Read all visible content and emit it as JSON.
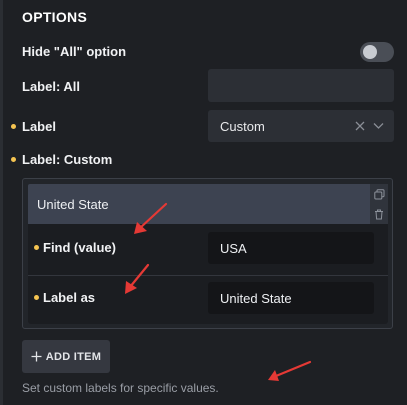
{
  "section": {
    "title": "OPTIONS"
  },
  "hide_all": {
    "label": "Hide \"All\" option",
    "enabled": false
  },
  "label_all": {
    "label": "Label: All",
    "value": ""
  },
  "label_select": {
    "label": "Label",
    "value": "Custom"
  },
  "label_custom": {
    "label": "Label: Custom",
    "items": [
      {
        "title": "United State",
        "find_label": "Find (value)",
        "find_value": "USA",
        "label_as_label": "Label as",
        "label_as_value": "United State"
      }
    ]
  },
  "add_item": {
    "label": "ADD ITEM"
  },
  "help_text": "Set custom labels for specific values.",
  "colors": {
    "required_dot": "#f5c451",
    "annotation_arrow": "#e53935"
  },
  "icons": [
    "plus-icon",
    "close-icon",
    "chevron-down-icon",
    "duplicate-icon",
    "trash-icon",
    "arrow-annotation"
  ]
}
